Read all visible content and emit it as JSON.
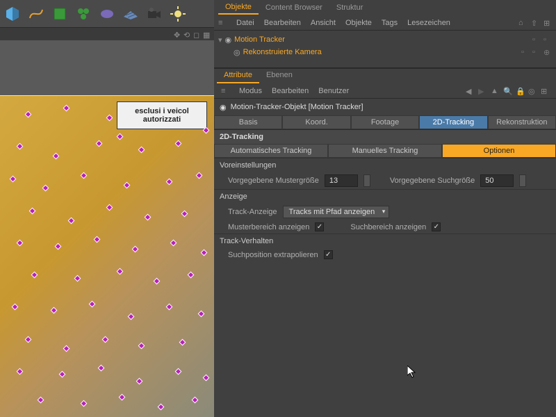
{
  "objects_panel": {
    "tabs": [
      "Objekte",
      "Content Browser",
      "Struktur"
    ],
    "menu": [
      "Datei",
      "Bearbeiten",
      "Ansicht",
      "Objekte",
      "Tags",
      "Lesezeichen"
    ],
    "tree": {
      "root": "Motion Tracker",
      "child": "Rekonstruierte Kamera"
    }
  },
  "attribute_panel": {
    "tabs": [
      "Attribute",
      "Ebenen"
    ],
    "menu": [
      "Modus",
      "Bearbeiten",
      "Benutzer"
    ],
    "header": "Motion-Tracker-Objekt [Motion Tracker]",
    "sub_tabs": [
      "Basis",
      "Koord.",
      "Footage",
      "2D-Tracking",
      "Rekonstruktion"
    ],
    "section": "2D-Tracking",
    "track_tabs": [
      "Automatisches Tracking",
      "Manuelles Tracking",
      "Optionen"
    ],
    "groups": {
      "voreinstellungen": {
        "title": "Voreinstellungen",
        "muster_label": "Vorgegebene Mustergröße",
        "muster_value": "13",
        "such_label": "Vorgegebene Suchgröße",
        "such_value": "50"
      },
      "anzeige": {
        "title": "Anzeige",
        "track_anzeige_label": "Track-Anzeige",
        "track_anzeige_value": "Tracks mit Pfad anzeigen",
        "musterbereich_label": "Musterbereich anzeigen",
        "musterbereich_checked": true,
        "suchbereich_label": "Suchbereich anzeigen",
        "suchbereich_checked": true
      },
      "verhalten": {
        "title": "Track-Verhalten",
        "extrapolieren_label": "Suchposition extrapolieren",
        "extrapolieren_checked": true
      }
    }
  },
  "viewport": {
    "sign_line1": "esclusi i veicol",
    "sign_line2": "autorizzati"
  },
  "toolbar_icons": [
    "cube",
    "spline",
    "nurbs",
    "sphere-cluster",
    "boolean",
    "floor",
    "camera",
    "light"
  ]
}
